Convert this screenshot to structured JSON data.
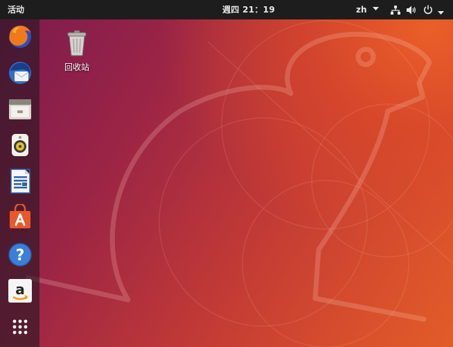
{
  "topbar": {
    "activities": "活动",
    "clock": "週四 21：19",
    "language": "zh"
  },
  "dock": {
    "apps": [
      {
        "icon": "firefox-icon"
      },
      {
        "icon": "thunderbird-icon"
      },
      {
        "icon": "files-icon"
      },
      {
        "icon": "rhythmbox-icon"
      },
      {
        "icon": "libreoffice-writer-icon"
      },
      {
        "icon": "software-center-icon"
      },
      {
        "icon": "help-icon"
      },
      {
        "icon": "amazon-icon"
      },
      {
        "icon": "show-applications-icon"
      }
    ]
  },
  "desktop": {
    "trash_label": "回收站"
  },
  "colors": {
    "topbar": "#1d1d1d",
    "wallpaper_orange": "#e25c28",
    "wallpaper_purple": "#7a1a4f",
    "dock_bg": "rgba(38,22,34,0.62)"
  }
}
